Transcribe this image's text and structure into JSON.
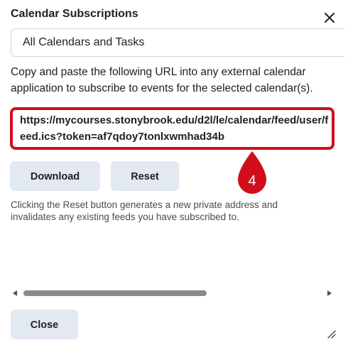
{
  "dialog": {
    "title": "Calendar Subscriptions",
    "close_icon": "close-icon"
  },
  "calendar_select": {
    "selected": "All Calendars and Tasks"
  },
  "instructions": "Copy and paste the following URL into any external calendar application to subscribe to events for the selected calendar(s).",
  "feed_url": "https://mycourses.stonybrook.edu/d2l/le/calendar/feed/user/feed.ics?token=af7qdoy7tonlxwmhad34b",
  "step_marker": {
    "number": "4",
    "color": "#d10f1b"
  },
  "buttons": {
    "download": "Download",
    "reset": "Reset",
    "close": "Close"
  },
  "reset_note": "Clicking the Reset button generates a new private address and invalidates any existing feeds you have subscribed to.",
  "colors": {
    "highlight": "#d10f1b",
    "button_bg": "#e3e9f1"
  }
}
